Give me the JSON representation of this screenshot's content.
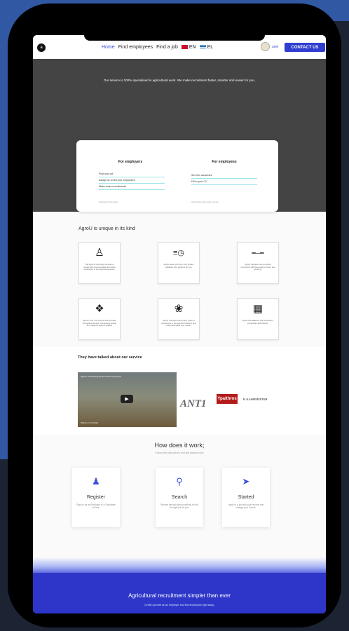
{
  "nav": {
    "logo": "a",
    "links": [
      "Home",
      "Find employees",
      "Find a job"
    ],
    "lang_en": "EN",
    "lang_el": "EL",
    "user": "user",
    "contact": "CONTACT US"
  },
  "hero": {
    "tagline": "Our service is 100% specialised in agricultural work. We make recruitment faster, smarter and easier for you.",
    "employers": {
      "title": "For employers",
      "items": [
        "Post your ad",
        "Assign us to find you employees",
        "Make mass recruitments"
      ],
      "note": "Package Information"
    },
    "employees": {
      "title": "For employees",
      "items": [
        "See the vacancies",
        "Fill in your CV"
      ],
      "note": "Information about the service"
    }
  },
  "unique": {
    "title": "AgroU is unique in its kind",
    "tiles": [
      {
        "icon": "farmer-icon",
        "text": "The AgroU community consists of people who are interested and active exclusively in the agricultural sector."
      },
      {
        "icon": "fast-clock-icon",
        "text": "AgroU saves you time. Our system validates your partners for you."
      },
      {
        "icon": "handshake-icon",
        "text": "AgroU members are an active community with thousands of users and growing."
      },
      {
        "icon": "greece-map-icon",
        "text": "AgroU is the only service that operates throughout Greece. Connecting people from different regions reliably."
      },
      {
        "icon": "plant-hand-icon",
        "text": "AgroU members have many years of experience in the agri-food industry and fully understand your needs."
      },
      {
        "icon": "network-icon",
        "text": "AgroU has alliances with employers, universities and industry."
      }
    ]
  },
  "talked": {
    "title": "They have talked about our service",
    "video_title": "AgroU: Connecting farmers with employees",
    "watch_on": "Watch on YouTube",
    "press": [
      "ANT1",
      "Ypaithros",
      "Η ΚΑΘΗΜΕΡΙΝΗ"
    ]
  },
  "how": {
    "title": "How does it work;",
    "subtitle": "Follow the instructions and get started now!",
    "steps": [
      {
        "icon": "user-icon",
        "title": "Register",
        "text": "Sign up as an Employer or a Candidate for free."
      },
      {
        "icon": "search-icon",
        "title": "Search",
        "text": "Browse through open positions to find the right job for you."
      },
      {
        "icon": "paper-plane-icon",
        "title": "Started",
        "text": "Apply to a job with your resume and change your Career."
      }
    ]
  },
  "footer": {
    "title": "Agricultural recruitment simpler than ever",
    "subtitle": "Certify yourself as an employer and find employees right away."
  }
}
